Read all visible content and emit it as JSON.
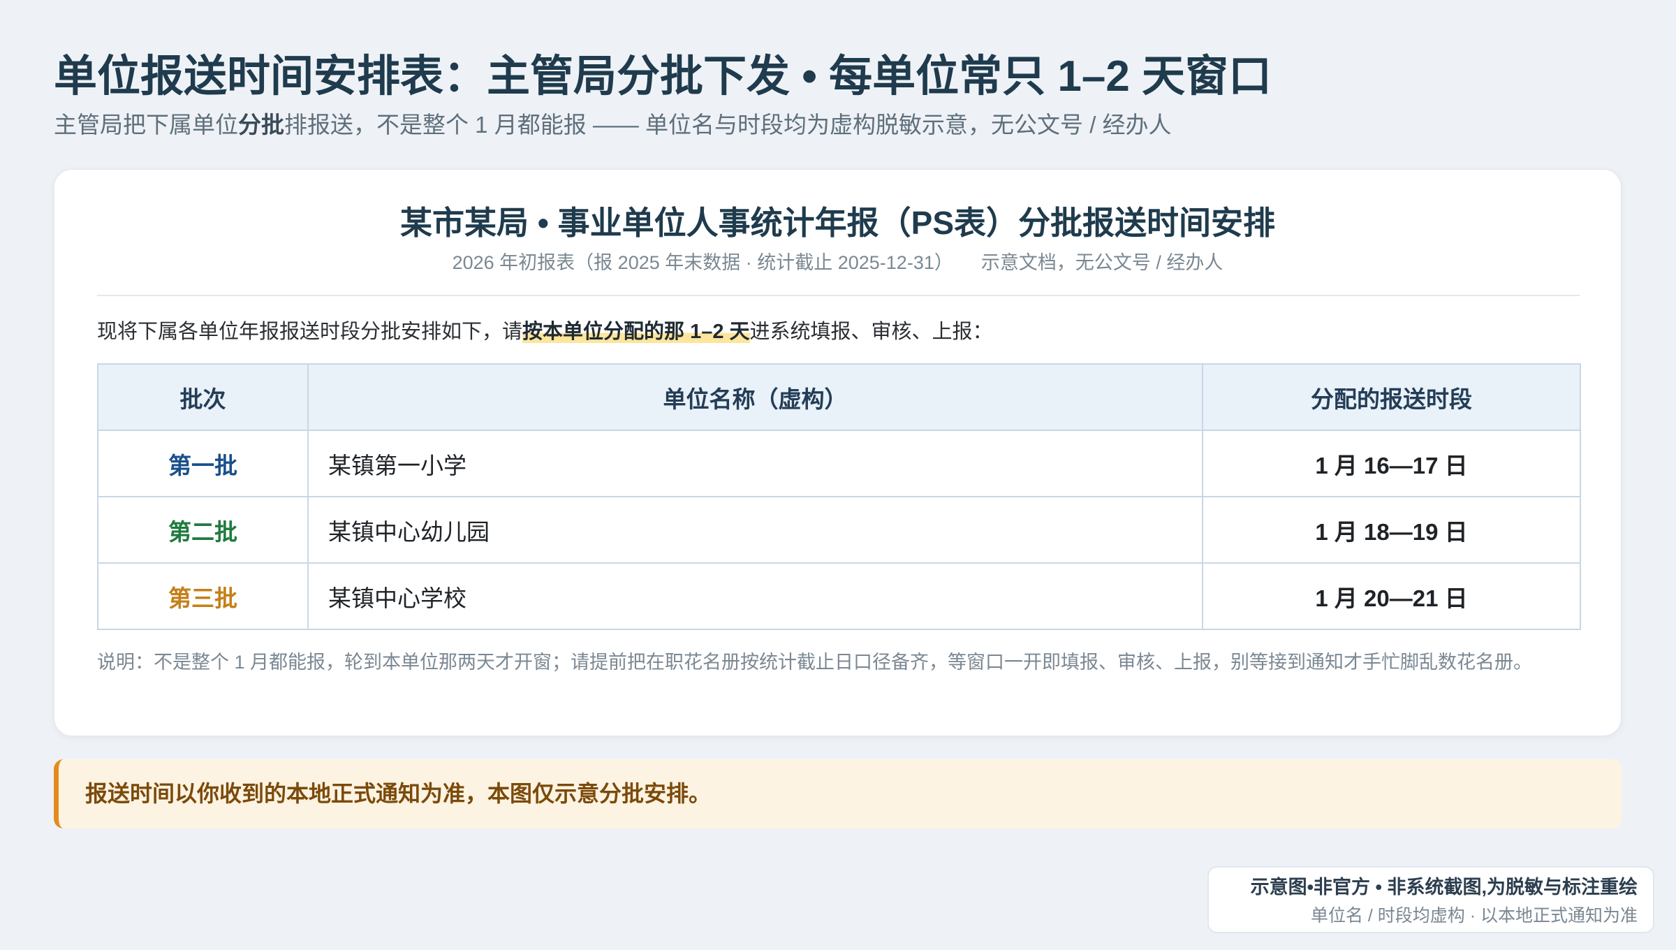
{
  "page": {
    "title": "单位报送时间安排表：主管局分批下发 • 每单位常只 1–2 天窗口",
    "subtitle": {
      "pre": "主管局把下属单位",
      "bold": "分批",
      "post": "排报送，不是整个 1 月都能报 —— 单位名与时段均为虚构脱敏示意，无公文号 / 经办人"
    }
  },
  "card": {
    "title": "某市某局 • 事业单位人事统计年报（PS表）分批报送时间安排",
    "meta_left": "2026 年初报表（报 2025 年末数据 · 统计截止 2025-12-31）",
    "meta_right": "示意文档，无公文号 / 经办人",
    "intro": {
      "pre": "现将下属各单位年报报送时段分批安排如下，请",
      "highlight": "按本单位分配的那 1–2 天",
      "post": "进系统填报、审核、上报："
    },
    "table": {
      "headers": [
        "批次",
        "单位名称（虚构）",
        "分配的报送时段"
      ],
      "rows": [
        {
          "batch": "第一批",
          "unit": "某镇第一小学",
          "period": "1 月 16—17 日",
          "batch_color": "#1a4f8b"
        },
        {
          "batch": "第二批",
          "unit": "某镇中心幼儿园",
          "period": "1 月 18—19 日",
          "batch_color": "#1f7a3d"
        },
        {
          "batch": "第三批",
          "unit": "某镇中心学校",
          "period": "1 月 20—21 日",
          "batch_color": "#c47f17"
        }
      ]
    },
    "note": "说明：不是整个 1 月都能报，轮到本单位那两天才开窗；请提前把在职花名册按统计截止日口径备齐，等窗口一开即填报、审核、上报，别等接到通知才手忙脚乱数花名册。"
  },
  "notice": {
    "text": "报送时间以你收到的本地正式通知为准，本图仅示意分批安排。",
    "accent_color": "#e38b1c"
  },
  "badge": {
    "line1": "示意图•非官方 • 非系统截图,为脱敏与标注重绘",
    "line2": "单位名 / 时段均虚构 · 以本地正式通知为准"
  },
  "colors": {
    "title": "#1f3b4d",
    "background": "#eef2f6",
    "table_header_bg": "#e9f1f9",
    "highlight": "#fde59b",
    "notice_bg": "#fdf3e2",
    "notice_text": "#7b4a0b"
  }
}
